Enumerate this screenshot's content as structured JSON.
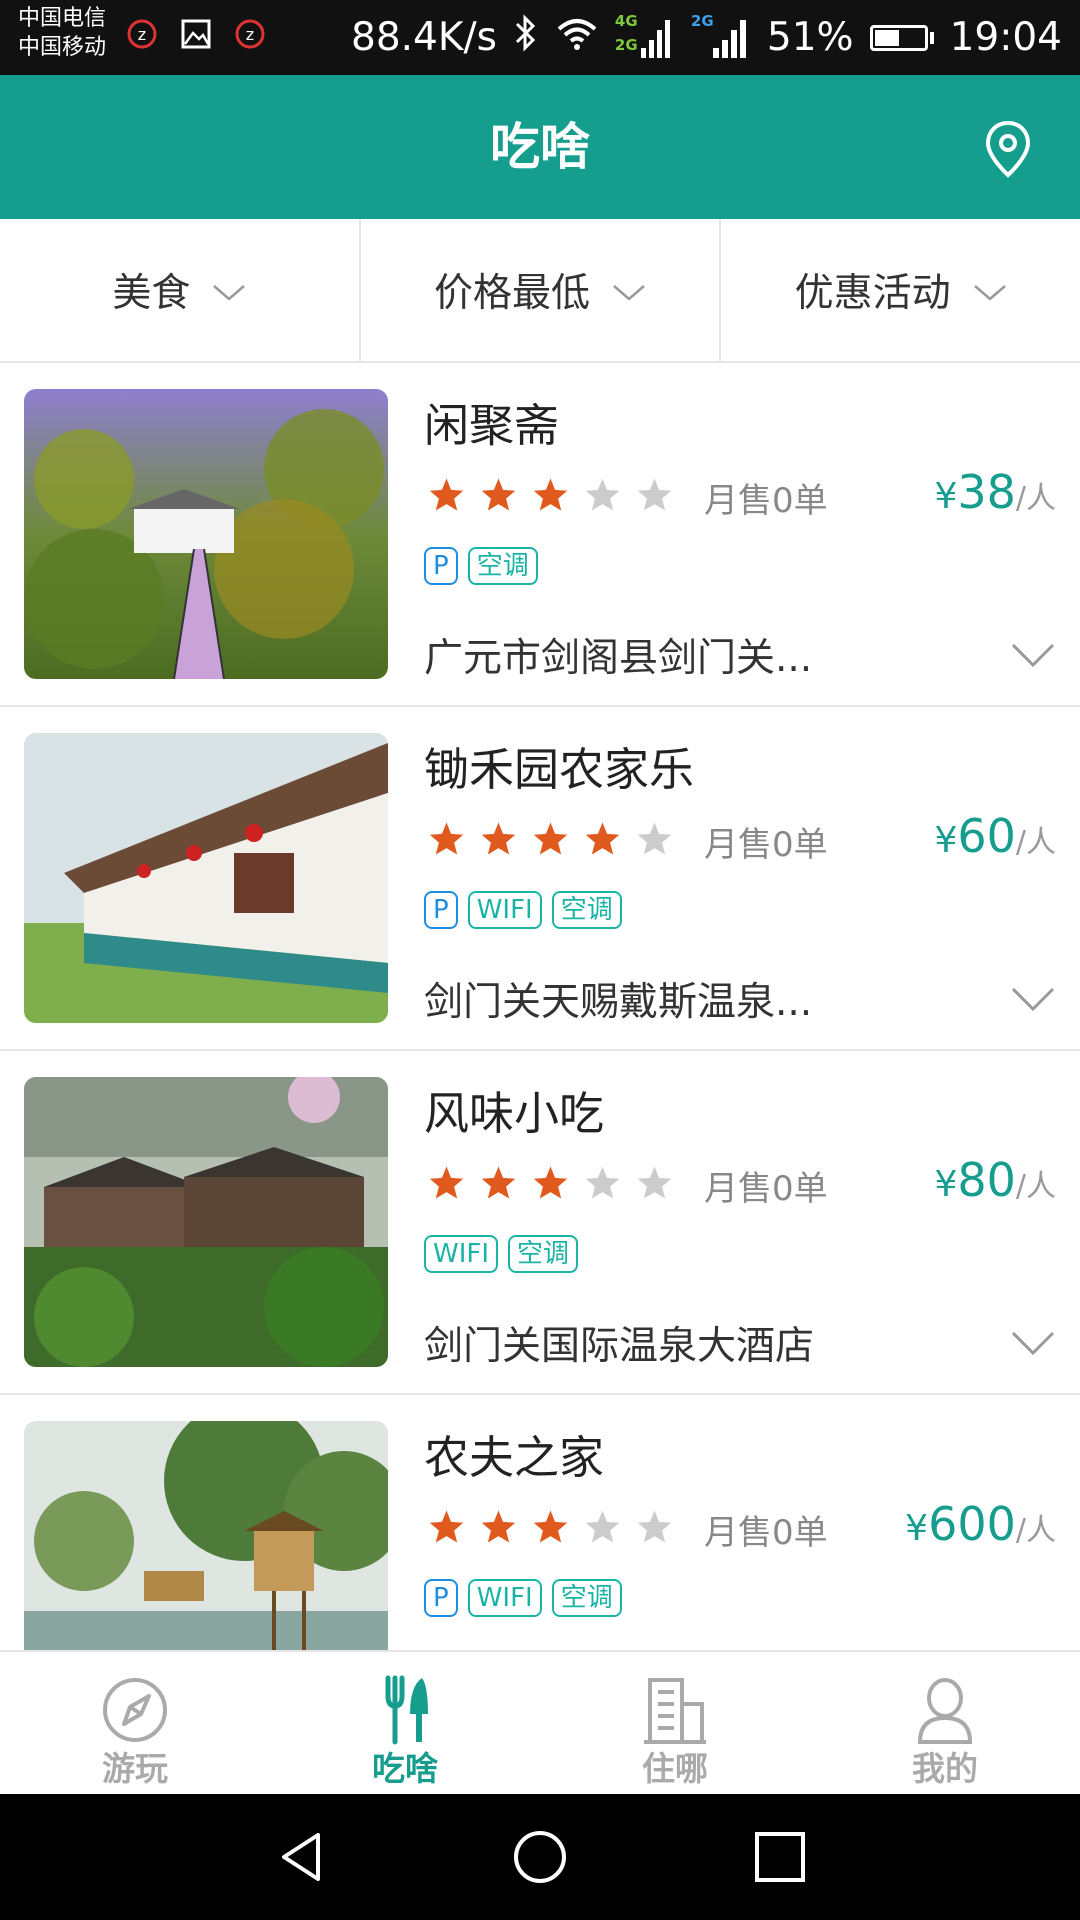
{
  "status_bar": {
    "carrier_1": "中国电信",
    "carrier_2": "中国移动",
    "net_speed": "88.4K/s",
    "net_4g": "4G",
    "net_2g_a": "2G",
    "net_2g_b": "2G",
    "battery_percent": "51%",
    "battery_level": 0.51,
    "time": "19:04"
  },
  "header": {
    "title": "吃啥",
    "location_icon": "location-pin-icon"
  },
  "filters": [
    {
      "label": "美食"
    },
    {
      "label": "价格最低"
    },
    {
      "label": "优惠活动"
    }
  ],
  "restaurants": [
    {
      "name": "闲聚斋",
      "rating": 3,
      "sales": "月售0单",
      "currency": "¥",
      "price": "38",
      "unit": "/人",
      "tags": [
        "P",
        "空调"
      ],
      "address": "广元市剑阁县剑门关..."
    },
    {
      "name": "锄禾园农家乐",
      "rating": 4,
      "sales": "月售0单",
      "currency": "¥",
      "price": "60",
      "unit": "/人",
      "tags": [
        "P",
        "WIFI",
        "空调"
      ],
      "address": "剑门关天赐戴斯温泉..."
    },
    {
      "name": "风味小吃",
      "rating": 3,
      "sales": "月售0单",
      "currency": "¥",
      "price": "80",
      "unit": "/人",
      "tags": [
        "WIFI",
        "空调"
      ],
      "address": "剑门关国际温泉大酒店"
    },
    {
      "name": "农夫之家",
      "rating": 3,
      "sales": "月售0单",
      "currency": "¥",
      "price": "600",
      "unit": "/人",
      "tags": [
        "P",
        "WIFI",
        "空调"
      ],
      "address": ""
    }
  ],
  "tabs": [
    {
      "label": "游玩",
      "icon": "compass-icon",
      "active": false
    },
    {
      "label": "吃啥",
      "icon": "fork-knife-icon",
      "active": true
    },
    {
      "label": "住哪",
      "icon": "building-icon",
      "active": false
    },
    {
      "label": "我的",
      "icon": "person-icon",
      "active": false
    }
  ],
  "colors": {
    "brand": "#159d8e",
    "star_on": "#e05a1e",
    "star_off": "#cccccc",
    "tag": "#1ab4a4",
    "parking_tag": "#1e8fe0"
  }
}
